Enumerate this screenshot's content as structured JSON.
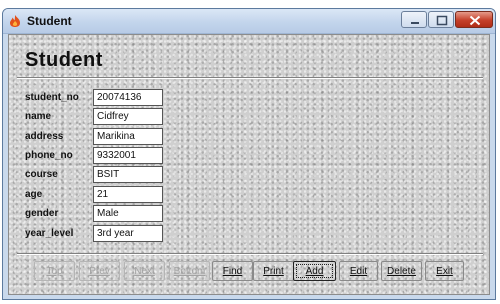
{
  "window": {
    "title": "Student"
  },
  "form": {
    "heading": "Student",
    "fields": [
      {
        "label": "student_no",
        "value": "20074136"
      },
      {
        "label": "name",
        "value": "Cidfrey"
      },
      {
        "label": "address",
        "value": "Marikina"
      },
      {
        "label": "phone_no",
        "value": "9332001"
      },
      {
        "label": "course",
        "value": "BSIT"
      },
      {
        "label": "age",
        "value": "21"
      },
      {
        "label": "gender",
        "value": "Male"
      },
      {
        "label": "year_level",
        "value": "3rd year"
      }
    ]
  },
  "buttons": {
    "top": "Top",
    "prev": "Prev",
    "next": "Next",
    "bottom": "Bottom",
    "find": "Find",
    "print": "Print",
    "add": "Add",
    "edit": "Edit",
    "delete": "Delete",
    "exit": "Exit"
  },
  "icons": {
    "app": "flame-icon",
    "minimize": "minimize-icon",
    "maximize": "maximize-icon",
    "close": "close-icon"
  },
  "colors": {
    "close_button": "#c5402a",
    "disabled_text": "#a3a3a3",
    "app_icon": "#e2521c"
  }
}
